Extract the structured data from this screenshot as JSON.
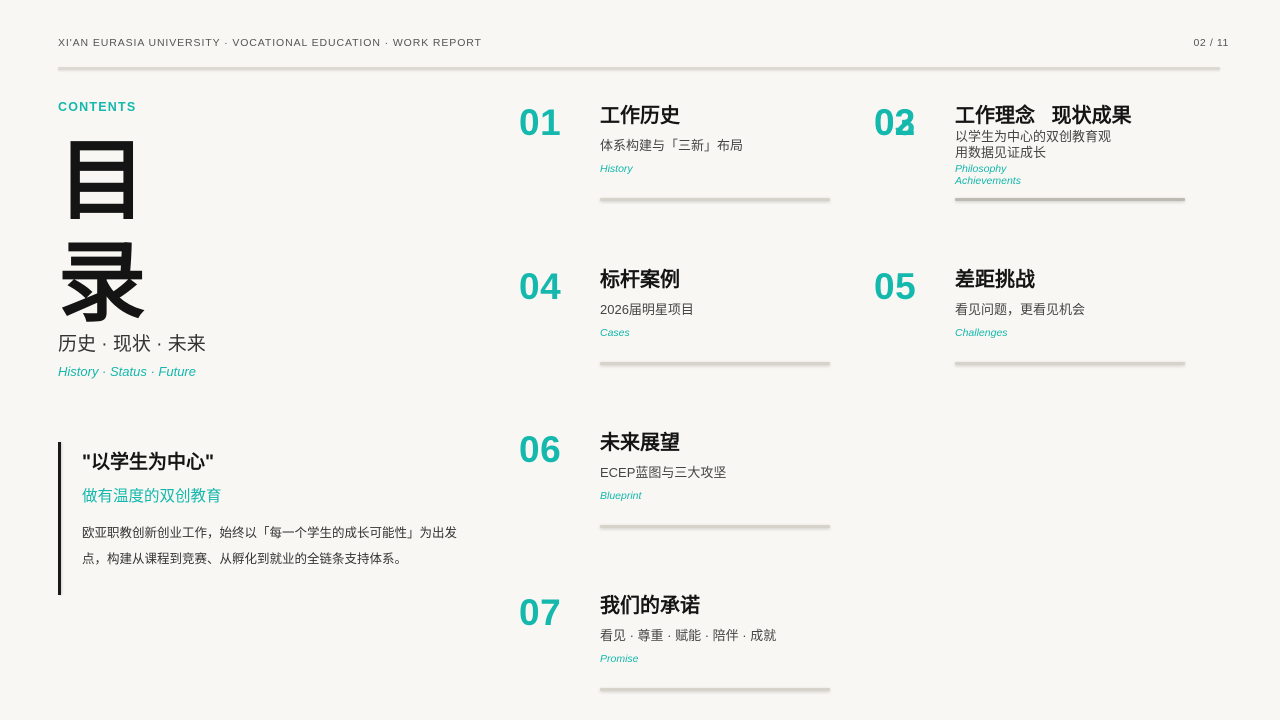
{
  "header": {
    "left": "XI'AN EURASIA UNIVERSITY · VOCATIONAL EDUCATION · WORK REPORT",
    "page": "02 / 11"
  },
  "contents_label": "CONTENTS",
  "title_chars": [
    "目",
    "录"
  ],
  "subtitle_cn": "历史 · 现状 · 未来",
  "subtitle_en": "History · Status · Future",
  "quote": {
    "title": "\"以学生为中心\"",
    "accent": "做有温度的双创教育",
    "body": "欧亚职教创新创业工作，始终以「每一个学生的成长可能性」为出发点，构建从课程到竞赛、从孵化到就业的全链条支持体系。"
  },
  "items": [
    {
      "num": "01",
      "title": "工作历史",
      "sub": "体系构建与「三新」布局",
      "en": "History"
    },
    {
      "num_a": "02",
      "num_b": "03",
      "title": "工作理念   现状成果",
      "sub_lines": [
        "以学生为中心的双创教育观",
        "用数据见证成长"
      ],
      "en_lines": [
        "Philosophy",
        "Achievements"
      ]
    },
    {
      "num": "04",
      "title": "标杆案例",
      "sub": "2026届明星项目",
      "en": "Cases"
    },
    {
      "num": "05",
      "title": "差距挑战",
      "sub": "看见问题，更看见机会",
      "en": "Challenges"
    },
    {
      "num": "06",
      "title": "未来展望",
      "sub": "ECEP蓝图与三大攻坚",
      "en": "Blueprint"
    },
    {
      "num": "07",
      "title": "我们的承诺",
      "sub": "看见 · 尊重 · 赋能 · 陪伴 · 成就",
      "en": "Promise"
    }
  ],
  "colors": {
    "accent": "#15b8ad",
    "text": "#141414",
    "background": "#f8f7f3"
  }
}
